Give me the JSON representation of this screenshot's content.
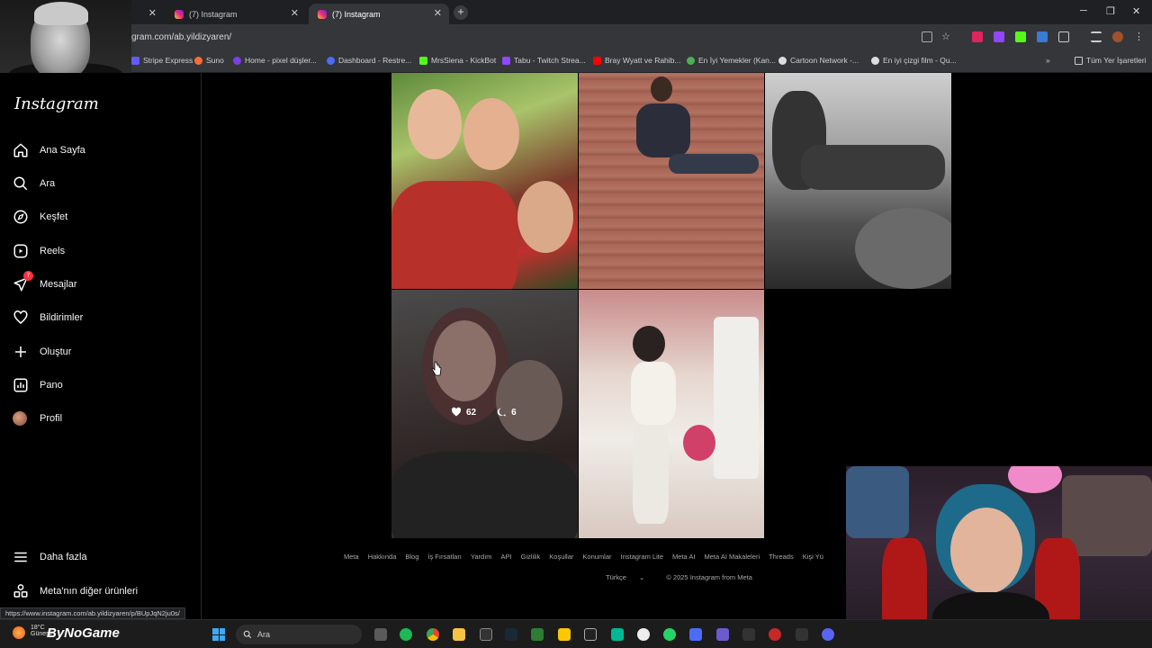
{
  "browser": {
    "tabs": [
      {
        "title": ""
      },
      {
        "title": "(7) Instagram"
      },
      {
        "title": "(7) Instagram"
      }
    ],
    "url": "gram.com/ab.yildizyaren/",
    "bookmarks": [
      "Stripe Express",
      "Suno",
      "Home - pixel düşler...",
      "Dashboard - Restre...",
      "MrsSiena - KickBot",
      "Tabu - Twitch Strea...",
      "Bray Wyatt ve Rahib...",
      "En İyi Yemekler (Kan...",
      "Cartoon Network -...",
      "En iyi çizgi film - Qu..."
    ],
    "all_bookmarks": "Tüm Yer İşaretleri"
  },
  "instagram": {
    "logo": "Instagram",
    "nav": [
      {
        "label": "Ana Sayfa",
        "icon": "home-icon"
      },
      {
        "label": "Ara",
        "icon": "search-icon"
      },
      {
        "label": "Keşfet",
        "icon": "compass-icon"
      },
      {
        "label": "Reels",
        "icon": "reels-icon"
      },
      {
        "label": "Mesajlar",
        "icon": "messenger-icon",
        "badge": "7"
      },
      {
        "label": "Bildirimler",
        "icon": "heart-icon"
      },
      {
        "label": "Oluştur",
        "icon": "plus-icon"
      },
      {
        "label": "Pano",
        "icon": "dashboard-icon"
      },
      {
        "label": "Profil",
        "icon": "avatar"
      }
    ],
    "more": "Daha fazla",
    "meta_products": "Meta'nın diğer ürünleri",
    "hovered_post": {
      "likes": "62",
      "comments": "6"
    },
    "footer_links": [
      "Meta",
      "Hakkında",
      "Blog",
      "İş Fırsatları",
      "Yardım",
      "API",
      "Gizlilik",
      "Koşullar",
      "Konumlar",
      "Instagram Lite",
      "Meta AI",
      "Meta AI Makaleleri",
      "Threads",
      "Kişi Yü"
    ],
    "language": "Türkçe",
    "copyright": "© 2025 Instagram from Meta"
  },
  "status_url": "https://www.instagram.com/ab.yildizyaren/p/BUpJqN2ju0s/",
  "taskbar": {
    "temperature": "18°C",
    "weather": "Güneşli",
    "brand": "ByNoGame",
    "search_placeholder": "Ara"
  }
}
